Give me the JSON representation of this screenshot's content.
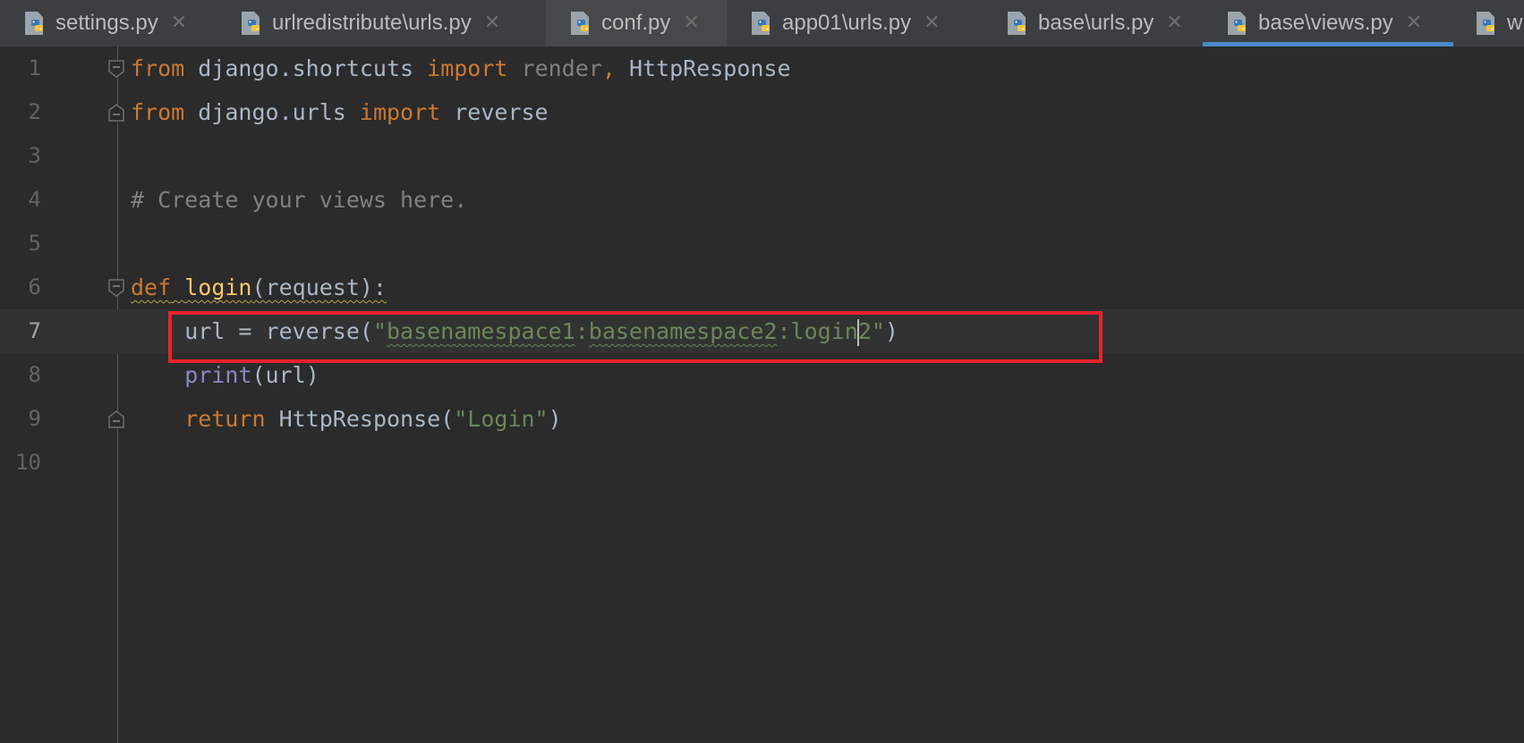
{
  "tabs": [
    {
      "label": "settings.py",
      "close": "✕"
    },
    {
      "label": "urlredistribute\\urls.py",
      "close": "✕"
    },
    {
      "label": "conf.py",
      "close": "✕"
    },
    {
      "label": "app01\\urls.py",
      "close": "✕"
    },
    {
      "label": "base\\urls.py",
      "close": "✕"
    },
    {
      "label": "base\\views.py",
      "close": "✕",
      "active": true
    },
    {
      "label": "w",
      "close": ""
    }
  ],
  "editor": {
    "current_line": 7,
    "lines": [
      {
        "num": "1",
        "tokens": [
          "from",
          " django.shortcuts ",
          "import",
          " render",
          ",",
          " HttpResponse"
        ]
      },
      {
        "num": "2",
        "tokens": [
          "from",
          " django.urls ",
          "import",
          " reverse"
        ]
      },
      {
        "num": "3",
        "tokens": []
      },
      {
        "num": "4",
        "tokens": [
          "# Create your views here."
        ]
      },
      {
        "num": "5",
        "tokens": []
      },
      {
        "num": "6",
        "tokens": [
          "def",
          " ",
          "login",
          "(request):"
        ]
      },
      {
        "num": "7",
        "tokens": [
          "    url = reverse(",
          "\"",
          "basenamespace1",
          ":",
          "basenamespace2",
          ":login",
          "2\"",
          ")"
        ]
      },
      {
        "num": "8",
        "tokens": [
          "    ",
          "print",
          "(url)"
        ]
      },
      {
        "num": "9",
        "tokens": [
          "    ",
          "return",
          " HttpResponse(",
          "\"Login\"",
          ")"
        ]
      },
      {
        "num": "10",
        "tokens": []
      }
    ]
  },
  "colors": {
    "background": "#2b2b2b",
    "keyword": "#cc7832",
    "function": "#ffc66d",
    "builtin": "#8888c6",
    "string": "#6a8759",
    "comment": "#808080",
    "text": "#a9b7c6",
    "highlight_box": "#e8232a",
    "active_tab_indicator": "#4a88c7"
  },
  "icons": {
    "tab": "python-file-icon",
    "fold": "fold-marker-icon"
  }
}
